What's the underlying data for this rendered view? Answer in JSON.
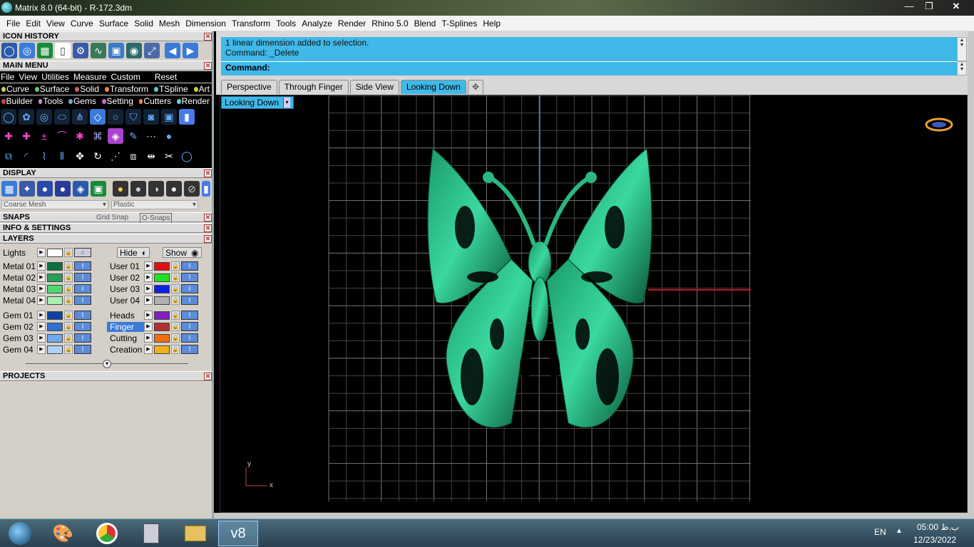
{
  "window": {
    "title": "Matrix 8.0 (64-bit) - R-172.3dm"
  },
  "menubar": [
    "File",
    "Edit",
    "View",
    "Curve",
    "Surface",
    "Solid",
    "Mesh",
    "Dimension",
    "Transform",
    "Tools",
    "Analyze",
    "Render",
    "Rhino 5.0",
    "Blend",
    "T-Splines",
    "Help"
  ],
  "panels": {
    "icon_history": "ICON HISTORY",
    "main_menu": "MAIN MENU",
    "display": "DISPLAY",
    "snaps": "SNAPS",
    "info": "INFO & SETTINGS",
    "layers": "LAYERS",
    "projects": "PROJECTS"
  },
  "main_menu_bar": {
    "items": [
      "File",
      "View",
      "Utilities",
      "Measure",
      "Custom"
    ],
    "reset": "Reset"
  },
  "mm_row1": [
    "Curve",
    "Surface",
    "Solid",
    "Transform",
    "TSpline",
    "Art"
  ],
  "mm_row2": [
    "Builder",
    "Tools",
    "Gems",
    "Setting",
    "Cutters",
    "Render"
  ],
  "display": {
    "mesh": "Coarse Mesh",
    "material": "Plastic"
  },
  "snaps": {
    "grid": "Grid Snap",
    "osnaps": "O-Snaps"
  },
  "layers": {
    "lights": "Lights",
    "hide": "Hide",
    "show": "Show",
    "left": [
      {
        "name": "Metal 01",
        "color": "#0e7040"
      },
      {
        "name": "Metal 02",
        "color": "#28a058"
      },
      {
        "name": "Metal 03",
        "color": "#50d870"
      },
      {
        "name": "Metal 04",
        "color": "#a8f0b0"
      },
      {
        "name": "Gem 01",
        "color": "#1040a0"
      },
      {
        "name": "Gem 02",
        "color": "#3070d0"
      },
      {
        "name": "Gem 03",
        "color": "#70a8f0"
      },
      {
        "name": "Gem 04",
        "color": "#b0d0f8"
      }
    ],
    "right": [
      {
        "name": "User 01",
        "color": "#e01010"
      },
      {
        "name": "User 02",
        "color": "#20e020"
      },
      {
        "name": "User 03",
        "color": "#1020e0"
      },
      {
        "name": "User 04",
        "color": "#b0b0b0"
      },
      {
        "name": "Heads",
        "color": "#8020c0"
      },
      {
        "name": "Finger",
        "color": "#b03030"
      },
      {
        "name": "Cutting",
        "color": "#f07010"
      },
      {
        "name": "Creation",
        "color": "#f0b020"
      }
    ]
  },
  "command": {
    "history": [
      "1 linear dimension added to selection.",
      "Command: _Delete"
    ],
    "prompt": "Command:"
  },
  "tabs": [
    "Perspective",
    "Through Finger",
    "Side View",
    "Looking Down"
  ],
  "viewport": {
    "name": "Looking Down",
    "axis_x": "x",
    "axis_y": "y"
  },
  "taskbar": {
    "lang": "EN",
    "time": "05:00 ب.ظ",
    "date": "12/23/2022"
  }
}
